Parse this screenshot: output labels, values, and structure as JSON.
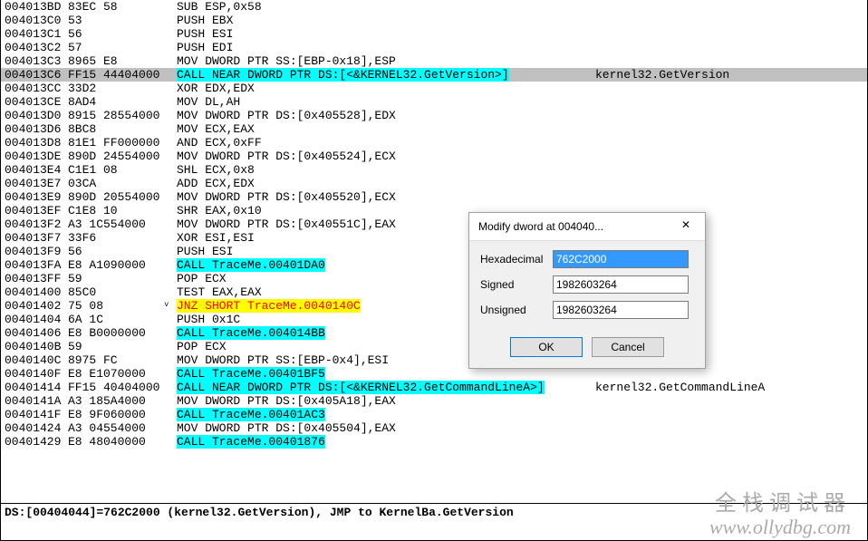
{
  "rows": [
    {
      "addr": "004013BD",
      "bytes": "83EC 58",
      "disasm": "SUB ESP,0x58",
      "hl": ""
    },
    {
      "addr": "004013C0",
      "bytes": "53",
      "disasm": "PUSH EBX",
      "hl": ""
    },
    {
      "addr": "004013C1",
      "bytes": "56",
      "disasm": "PUSH ESI",
      "hl": ""
    },
    {
      "addr": "004013C2",
      "bytes": "57",
      "disasm": "PUSH EDI",
      "hl": ""
    },
    {
      "addr": "004013C3",
      "bytes": "8965 E8",
      "disasm": "MOV DWORD PTR SS:[EBP-0x18],ESP",
      "hl": ""
    },
    {
      "addr": "004013C6",
      "bytes": "FF15 44404000",
      "disasm": "CALL NEAR DWORD PTR DS:[<&KERNEL32.GetVersion>]",
      "hl": "cyan",
      "selected": true,
      "comment": "kernel32.GetVersion"
    },
    {
      "addr": "004013CC",
      "bytes": "33D2",
      "disasm": "XOR EDX,EDX",
      "hl": ""
    },
    {
      "addr": "004013CE",
      "bytes": "8AD4",
      "disasm": "MOV DL,AH",
      "hl": ""
    },
    {
      "addr": "004013D0",
      "bytes": "8915 28554000",
      "disasm": "MOV DWORD PTR DS:[0x405528],EDX",
      "hl": ""
    },
    {
      "addr": "004013D6",
      "bytes": "8BC8",
      "disasm": "MOV ECX,EAX",
      "hl": ""
    },
    {
      "addr": "004013D8",
      "bytes": "81E1 FF000000",
      "disasm": "AND ECX,0xFF",
      "hl": ""
    },
    {
      "addr": "004013DE",
      "bytes": "890D 24554000",
      "disasm": "MOV DWORD PTR DS:[0x405524],ECX",
      "hl": ""
    },
    {
      "addr": "004013E4",
      "bytes": "C1E1 08",
      "disasm": "SHL ECX,0x8",
      "hl": ""
    },
    {
      "addr": "004013E7",
      "bytes": "03CA",
      "disasm": "ADD ECX,EDX",
      "hl": ""
    },
    {
      "addr": "004013E9",
      "bytes": "890D 20554000",
      "disasm": "MOV DWORD PTR DS:[0x405520],ECX",
      "hl": ""
    },
    {
      "addr": "004013EF",
      "bytes": "C1E8 10",
      "disasm": "SHR EAX,0x10",
      "hl": ""
    },
    {
      "addr": "004013F2",
      "bytes": "A3 1C554000",
      "disasm": "MOV DWORD PTR DS:[0x40551C],EAX",
      "hl": ""
    },
    {
      "addr": "004013F7",
      "bytes": "33F6",
      "disasm": "XOR ESI,ESI",
      "hl": ""
    },
    {
      "addr": "004013F9",
      "bytes": "56",
      "disasm": "PUSH ESI",
      "hl": ""
    },
    {
      "addr": "004013FA",
      "bytes": "E8 A1090000",
      "disasm": "CALL TraceMe.00401DA0",
      "hl": "cyan"
    },
    {
      "addr": "004013FF",
      "bytes": "59",
      "disasm": "POP ECX",
      "hl": ""
    },
    {
      "addr": "00401400",
      "bytes": "85C0",
      "disasm": "TEST EAX,EAX",
      "hl": ""
    },
    {
      "addr": "00401402",
      "bytes": "75 08",
      "disasm": "JNZ SHORT TraceMe.0040140C",
      "hl": "yellow",
      "jmpmark": true
    },
    {
      "addr": "00401404",
      "bytes": "6A 1C",
      "disasm": "PUSH 0x1C",
      "hl": ""
    },
    {
      "addr": "00401406",
      "bytes": "E8 B0000000",
      "disasm": "CALL TraceMe.004014BB",
      "hl": "cyan"
    },
    {
      "addr": "0040140B",
      "bytes": "59",
      "disasm": "POP ECX",
      "hl": ""
    },
    {
      "addr": "0040140C",
      "bytes": "8975 FC",
      "disasm": "MOV DWORD PTR SS:[EBP-0x4],ESI",
      "hl": ""
    },
    {
      "addr": "0040140F",
      "bytes": "E8 E1070000",
      "disasm": "CALL TraceMe.00401BF5",
      "hl": "cyan"
    },
    {
      "addr": "00401414",
      "bytes": "FF15 40404000",
      "disasm": "CALL NEAR DWORD PTR DS:[<&KERNEL32.GetCommandLineA>]",
      "hl": "cyan",
      "comment": "kernel32.GetCommandLineA"
    },
    {
      "addr": "0040141A",
      "bytes": "A3 185A4000",
      "disasm": "MOV DWORD PTR DS:[0x405A18],EAX",
      "hl": ""
    },
    {
      "addr": "0040141F",
      "bytes": "E8 9F060000",
      "disasm": "CALL TraceMe.00401AC3",
      "hl": "cyan"
    },
    {
      "addr": "00401424",
      "bytes": "A3 04554000",
      "disasm": "MOV DWORD PTR DS:[0x405504],EAX",
      "hl": ""
    },
    {
      "addr": "00401429",
      "bytes": "E8 48040000",
      "disasm": "CALL TraceMe.00401876",
      "hl": "cyan"
    }
  ],
  "status": "DS:[00404044]=762C2000 (kernel32.GetVersion), JMP to KernelBa.GetVersion",
  "dialog": {
    "title": "Modify dword at 004040...",
    "fields": {
      "hex_label": "Hexadecimal",
      "hex_value": "762C2000",
      "signed_label": "Signed",
      "signed_value": "1982603264",
      "unsigned_label": "Unsigned",
      "unsigned_value": "1982603264"
    },
    "ok": "OK",
    "cancel": "Cancel"
  },
  "watermark": {
    "line1": "全栈调试器",
    "line2": "www.ollydbg.com"
  }
}
